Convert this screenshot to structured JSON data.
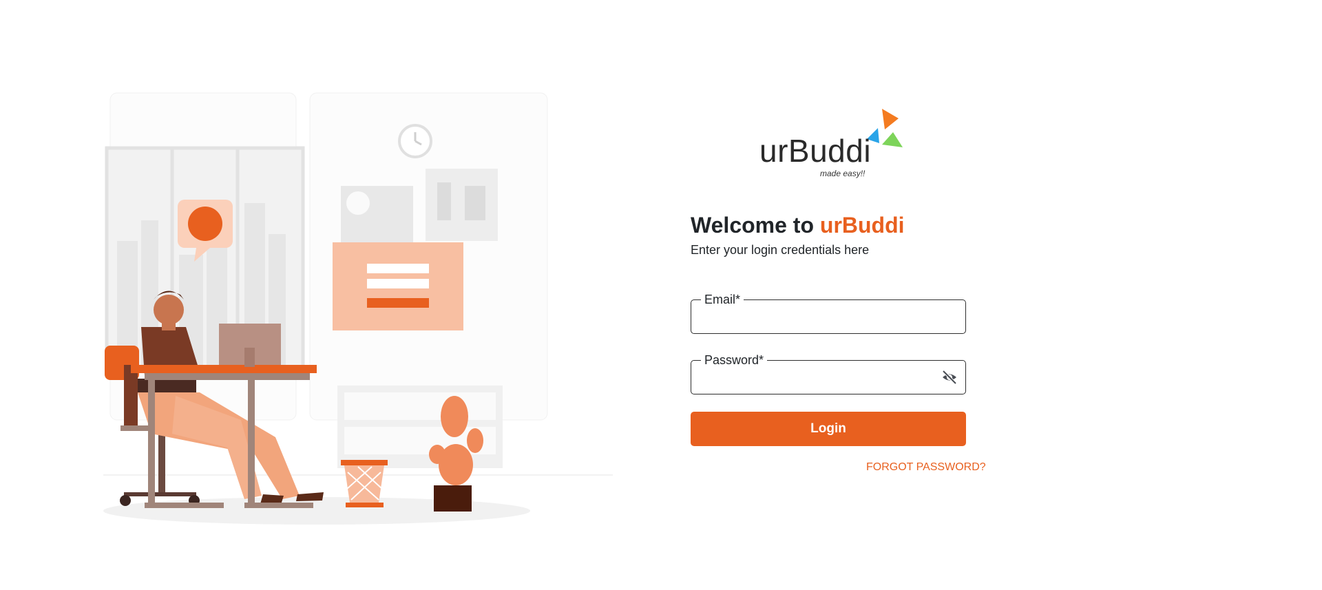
{
  "brand": {
    "wordmark": "urBuddi",
    "tagline": "made easy!!",
    "colors": {
      "orange": "#e8601f",
      "blue": "#2aa4e8",
      "green": "#7dd45a"
    }
  },
  "welcome": {
    "prefix": "Welcome to ",
    "brand": "urBuddi"
  },
  "subtitle": "Enter your login credentials here",
  "form": {
    "email": {
      "label": "Email*",
      "value": ""
    },
    "password": {
      "label": "Password*",
      "value": "",
      "toggle_icon": "eye-slash-icon"
    },
    "login_label": "Login",
    "forgot_label": "FORGOT PASSWORD?"
  }
}
